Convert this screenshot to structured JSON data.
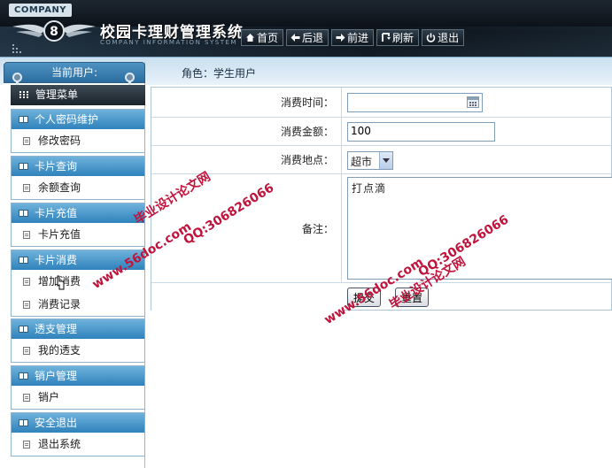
{
  "header": {
    "company": "COMPANY",
    "title": "校园卡理财管理系统",
    "subtitle": "COMPANY INFORMATION SYSTEM",
    "toolbar": [
      {
        "label": "首页",
        "icon": "home-icon"
      },
      {
        "label": "后退",
        "icon": "arrow-left-icon"
      },
      {
        "label": "前进",
        "icon": "arrow-right-icon"
      },
      {
        "label": "刷新",
        "icon": "refresh-icon"
      },
      {
        "label": "退出",
        "icon": "power-icon"
      }
    ]
  },
  "subbar": {
    "role": "角色：学生用户"
  },
  "sidebar": {
    "current_user": "当前用户:",
    "menu_title": "管理菜单",
    "groups": [
      {
        "title": "个人密码维护",
        "items": [
          "修改密码"
        ]
      },
      {
        "title": "卡片查询",
        "items": [
          "余额查询"
        ]
      },
      {
        "title": "卡片充值",
        "items": [
          "卡片充值"
        ]
      },
      {
        "title": "卡片消费",
        "items": [
          "增加消费",
          "消费记录"
        ]
      },
      {
        "title": "透支管理",
        "items": [
          "我的透支"
        ]
      },
      {
        "title": "销户管理",
        "items": [
          "销户"
        ]
      },
      {
        "title": "安全退出",
        "items": [
          "退出系统"
        ]
      }
    ]
  },
  "form": {
    "time_label": "消费时间：",
    "time_value": "",
    "amount_label": "消费金额：",
    "amount_value": "100",
    "place_label": "消费地点：",
    "place_value": "超市",
    "note_label": "备注：",
    "note_value": "打点滴",
    "submit_label": "提交",
    "reset_label": "重置"
  },
  "watermarks": {
    "site": "www.56doc.com",
    "qq": "QQ:306826066",
    "brand": "毕业设计论文网"
  },
  "colors": {
    "accent": "#2f82bb",
    "header_dark": "#0a0f16",
    "watermark": "#c0143c"
  }
}
